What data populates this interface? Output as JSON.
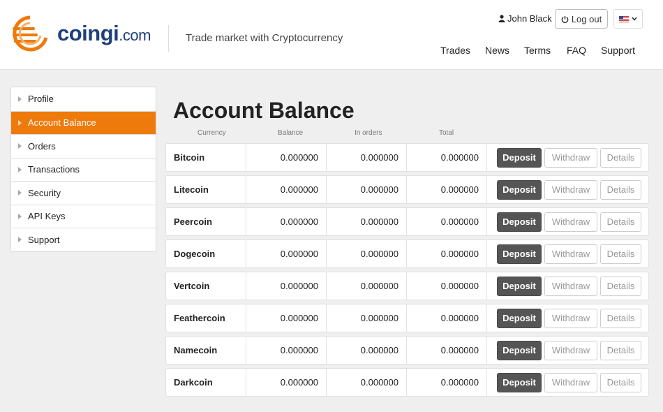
{
  "brand": {
    "name": "coingi",
    "domain": ".com",
    "accent": "#ee7a0b",
    "navy": "#1f3f7a"
  },
  "header": {
    "tagline": "Trade market with Cryptocurrency",
    "user_name": "John Black",
    "logout_label": "Log out",
    "nav": [
      "Trades",
      "News",
      "Terms",
      "FAQ",
      "Support"
    ]
  },
  "sidebar": {
    "items": [
      {
        "label": "Profile",
        "active": false
      },
      {
        "label": "Account Balance",
        "active": true
      },
      {
        "label": "Orders",
        "active": false
      },
      {
        "label": "Transactions",
        "active": false
      },
      {
        "label": "Security",
        "active": false
      },
      {
        "label": "API Keys",
        "active": false
      },
      {
        "label": "Support",
        "active": false
      }
    ]
  },
  "main": {
    "title": "Account Balance",
    "columns": [
      "Currency",
      "Balance",
      "In orders",
      "Total"
    ],
    "actions": {
      "deposit": "Deposit",
      "withdraw": "Withdraw",
      "details": "Details"
    },
    "rows": [
      {
        "currency": "Bitcoin",
        "balance": "0.000000",
        "in_orders": "0.000000",
        "total": "0.000000"
      },
      {
        "currency": "Litecoin",
        "balance": "0.000000",
        "in_orders": "0.000000",
        "total": "0.000000"
      },
      {
        "currency": "Peercoin",
        "balance": "0.000000",
        "in_orders": "0.000000",
        "total": "0.000000"
      },
      {
        "currency": "Dogecoin",
        "balance": "0.000000",
        "in_orders": "0.000000",
        "total": "0.000000"
      },
      {
        "currency": "Vertcoin",
        "balance": "0.000000",
        "in_orders": "0.000000",
        "total": "0.000000"
      },
      {
        "currency": "Feathercoin",
        "balance": "0.000000",
        "in_orders": "0.000000",
        "total": "0.000000"
      },
      {
        "currency": "Namecoin",
        "balance": "0.000000",
        "in_orders": "0.000000",
        "total": "0.000000"
      },
      {
        "currency": "Darkcoin",
        "balance": "0.000000",
        "in_orders": "0.000000",
        "total": "0.000000"
      }
    ]
  }
}
